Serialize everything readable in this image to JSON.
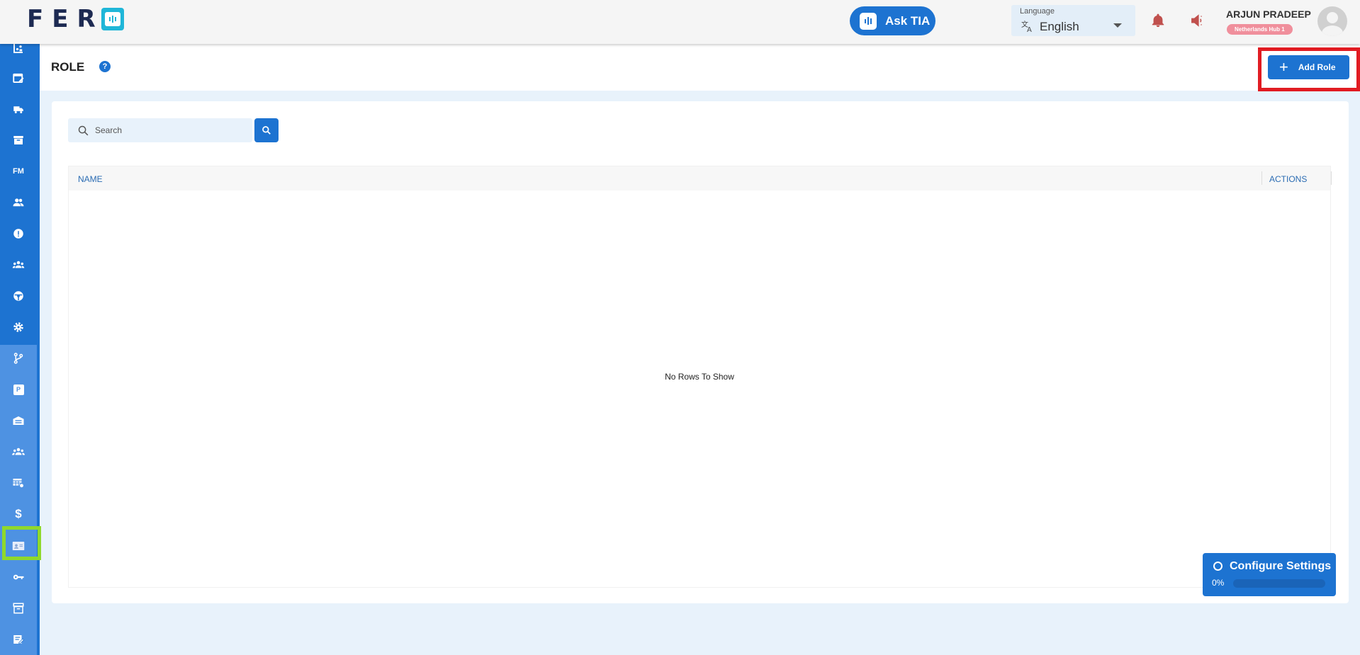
{
  "app": {
    "logo_text": "FER"
  },
  "header": {
    "ask_tia_label": "Ask TIA",
    "language": {
      "label": "Language",
      "value": "English"
    },
    "user": {
      "name": "ARJUN PRADEEP",
      "hub": "Netherlands Hub 1"
    }
  },
  "sidebar": {
    "items": [
      {
        "icon": "analytics-icon"
      },
      {
        "icon": "calendar-edit-icon"
      },
      {
        "icon": "truck-icon"
      },
      {
        "icon": "archive-icon"
      },
      {
        "icon": "fm-icon",
        "text": "FM"
      },
      {
        "icon": "users-icon"
      },
      {
        "icon": "info-icon"
      },
      {
        "icon": "team-icon"
      },
      {
        "icon": "driver-icon"
      },
      {
        "icon": "settings-icon"
      },
      {
        "icon": "branch-icon"
      },
      {
        "icon": "parking-icon",
        "text": "P"
      },
      {
        "icon": "warehouse-icon"
      },
      {
        "icon": "group-icon"
      },
      {
        "icon": "table-settings-icon"
      },
      {
        "icon": "dollar-icon",
        "text": "$"
      },
      {
        "icon": "id-card-icon"
      },
      {
        "icon": "key-icon"
      },
      {
        "icon": "box-icon"
      },
      {
        "icon": "note-edit-icon"
      }
    ]
  },
  "page": {
    "title": "ROLE",
    "help_symbol": "?",
    "add_button_label": "Add Role"
  },
  "search": {
    "placeholder": "Search",
    "value": ""
  },
  "table": {
    "columns": [
      "NAME",
      "ACTIONS"
    ],
    "rows": [],
    "empty_text": "No Rows To Show"
  },
  "configure": {
    "title": "Configure Settings",
    "progress_label": "0%",
    "progress": 0
  },
  "colors": {
    "primary": "#1d73d1",
    "sidebar_sub": "#4e92e2",
    "logo_accent": "#1fb6d8",
    "highlight_red": "#e11b22",
    "highlight_green": "#8fd82c",
    "alert": "#c0504d",
    "badge": "#f08f9c"
  }
}
